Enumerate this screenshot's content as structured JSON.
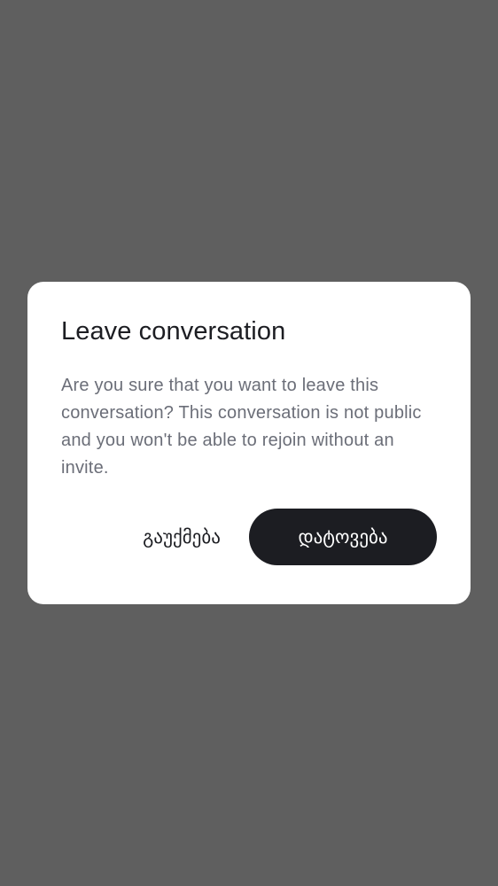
{
  "dialog": {
    "title": "Leave conversation",
    "message": "Are you sure that you want to leave this conversation? This conversation is not public and you won't be able to rejoin without an invite.",
    "cancel_label": "გაუქმება",
    "confirm_label": "დატოვება"
  },
  "colors": {
    "scrim": "#5f5f5f",
    "dialog_bg": "#ffffff",
    "title_text": "#1c1d22",
    "message_text": "#6b6e78",
    "confirm_bg": "#1c1d22",
    "confirm_text": "#ffffff"
  }
}
